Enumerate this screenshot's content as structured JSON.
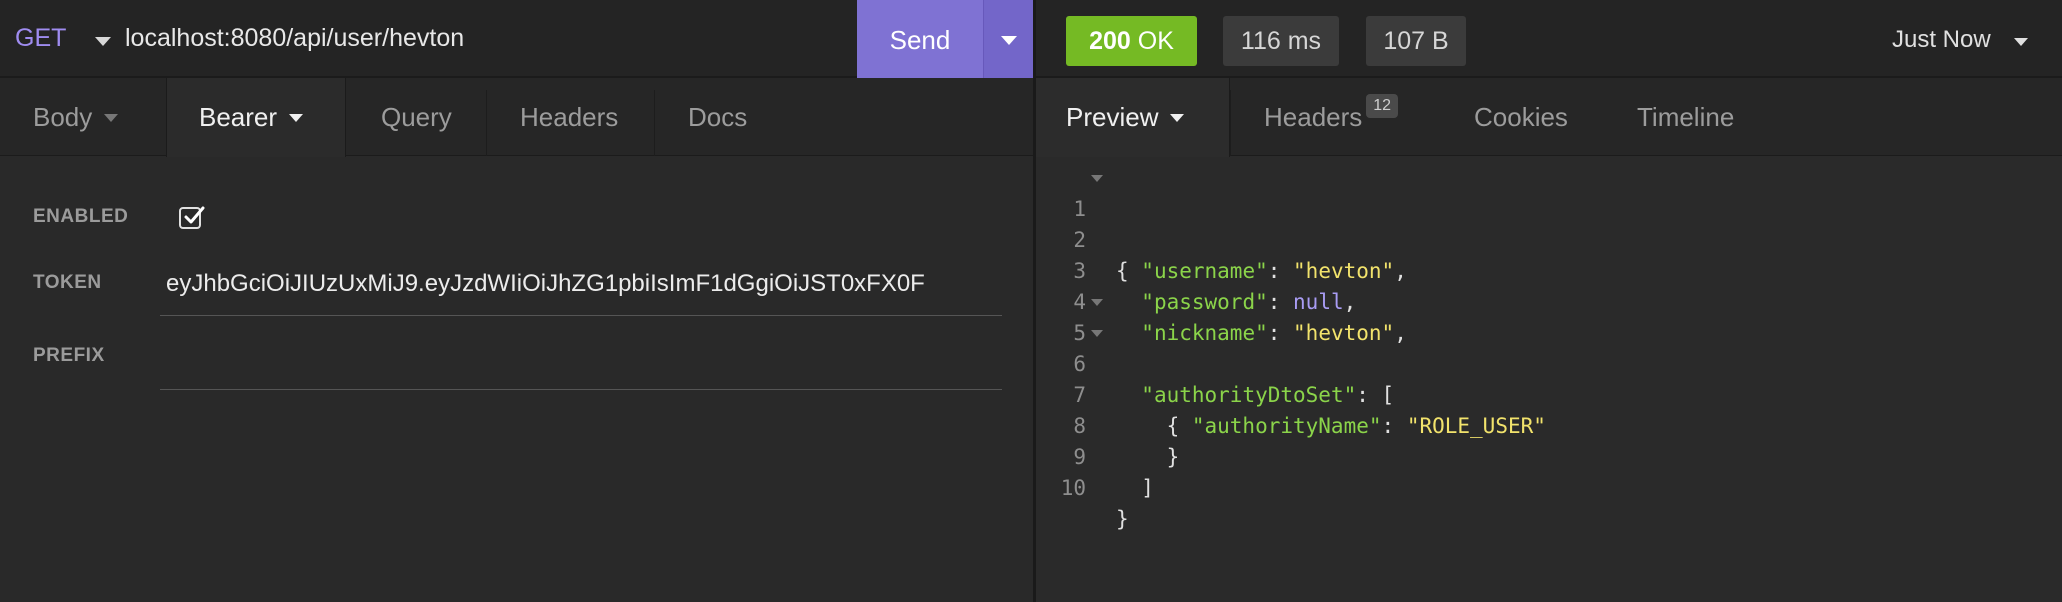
{
  "request": {
    "method": "GET",
    "url": "localhost:8080/api/user/hevton",
    "send_label": "Send"
  },
  "request_tabs": [
    {
      "label": "Body"
    },
    {
      "label": "Bearer"
    },
    {
      "label": "Query"
    },
    {
      "label": "Headers"
    },
    {
      "label": "Docs"
    }
  ],
  "auth": {
    "enabled_label": "ENABLED",
    "enabled": true,
    "token_label": "TOKEN",
    "token_value": "eyJhbGciOiJIUzUxMiJ9.eyJzdWIiOiJhZG1pbiIsImF1dGgiOiJST0xFX0F",
    "prefix_label": "PREFIX",
    "prefix_value": ""
  },
  "response": {
    "status_code": "200",
    "status_text": "OK",
    "time": "116 ms",
    "size": "107 B",
    "when": "Just Now"
  },
  "response_tabs": [
    {
      "label": "Preview"
    },
    {
      "label": "Headers",
      "badge": "12"
    },
    {
      "label": "Cookies"
    },
    {
      "label": "Timeline"
    }
  ],
  "preview_lines": [
    {
      "num": "1"
    },
    {
      "num": "2",
      "key": "\"username\"",
      "value": "\"hevton\""
    },
    {
      "num": "3",
      "key": "\"password\"",
      "value": "null"
    },
    {
      "num": "4",
      "key": "\"nickname\"",
      "value": "\"hevton\""
    },
    {
      "num": "5",
      "key": "\"authorityDtoSet\""
    },
    {
      "num": "6"
    },
    {
      "num": "7",
      "key": "\"authorityName\"",
      "value": "\"ROLE_USER\""
    },
    {
      "num": "8"
    },
    {
      "num": "9"
    },
    {
      "num": "10"
    }
  ],
  "colors": {
    "accent": "#7f72d3",
    "status_ok": "#75ba24",
    "json_key": "#8bd44a",
    "json_string": "#f2e36c",
    "json_null": "#a99cf4"
  }
}
